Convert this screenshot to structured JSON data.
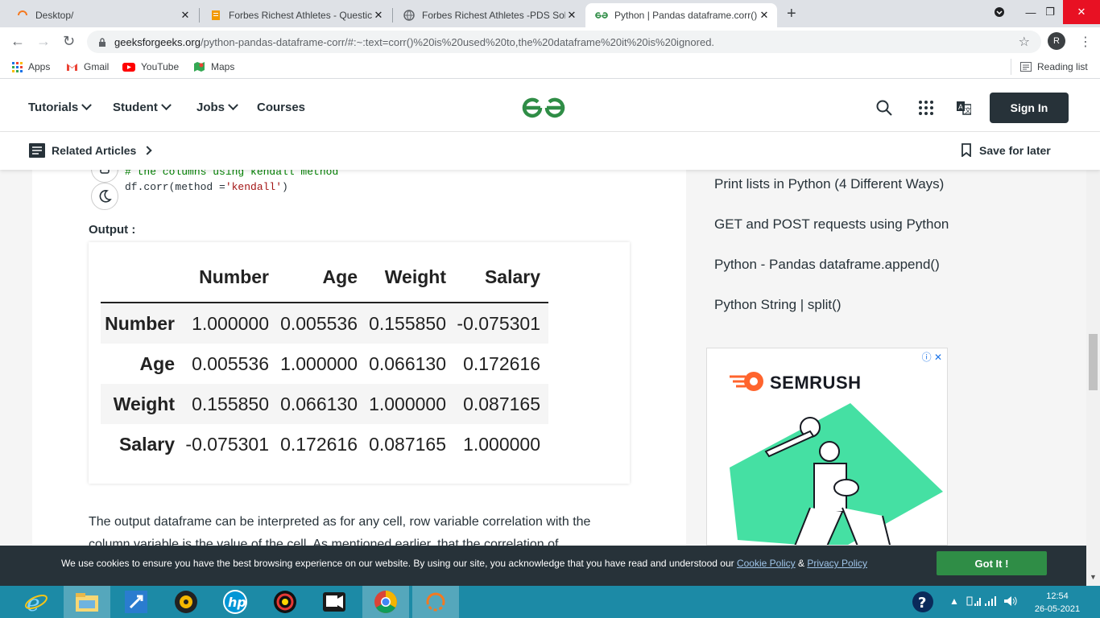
{
  "browser": {
    "tabs": [
      {
        "title": "Desktop/",
        "active": false
      },
      {
        "title": "Forbes Richest Athletes - Questic",
        "active": false
      },
      {
        "title": "Forbes Richest Athletes -PDS Sol",
        "active": false
      },
      {
        "title": "Python | Pandas dataframe.corr()",
        "active": true
      }
    ],
    "url_domain": "geeksforgeeks.org",
    "url_path": "/python-pandas-dataframe-corr/#:~:text=corr()%20is%20used%20to,the%20dataframe%20it%20is%20ignored.",
    "profile_initial": "R",
    "bookmarks": [
      "Apps",
      "Gmail",
      "YouTube",
      "Maps"
    ],
    "reading_list": "Reading list"
  },
  "gfg": {
    "nav": [
      "Tutorials",
      "Student",
      "Jobs",
      "Courses"
    ],
    "sign_in": "Sign In",
    "related_articles": "Related Articles",
    "save_for_later": "Save for later"
  },
  "article": {
    "code_comment": "# the columns using kendall method",
    "code_prefix": "df.corr(method =",
    "code_string": "'kendall'",
    "code_suffix": ")",
    "output_label": "Output :",
    "paragraph": "The output dataframe can be interpreted as for any cell, row variable correlation with the column variable is the value of the cell. As mentioned earlier, that the correlation of"
  },
  "dataframe": {
    "columns": [
      "Number",
      "Age",
      "Weight",
      "Salary"
    ],
    "rows": [
      {
        "index": "Number",
        "values": [
          "1.000000",
          "0.005536",
          "0.155850",
          "-0.075301"
        ]
      },
      {
        "index": "Age",
        "values": [
          "0.005536",
          "1.000000",
          "0.066130",
          "0.172616"
        ]
      },
      {
        "index": "Weight",
        "values": [
          "0.155850",
          "0.066130",
          "1.000000",
          "0.087165"
        ]
      },
      {
        "index": "Salary",
        "values": [
          "-0.075301",
          "0.172616",
          "0.087165",
          "1.000000"
        ]
      }
    ]
  },
  "sidebar": {
    "links": [
      "Print lists in Python (4 Different Ways)",
      "GET and POST requests using Python",
      "Python - Pandas dataframe.append()",
      "Python String | split()"
    ],
    "ad_brand": "SEMRUSH"
  },
  "cookie": {
    "text": "We use cookies to ensure you have the best browsing experience on our website. By using our site, you acknowledge that you have read and understood our ",
    "cookie_policy": "Cookie Policy",
    "amp": " & ",
    "privacy_policy": "Privacy Policy",
    "button": "Got It !"
  },
  "taskbar": {
    "time": "12:54",
    "date": "26-05-2021"
  },
  "colors": {
    "gfg_green": "#2f8d46",
    "dark": "#273239",
    "taskbar": "#1c8aa6"
  }
}
